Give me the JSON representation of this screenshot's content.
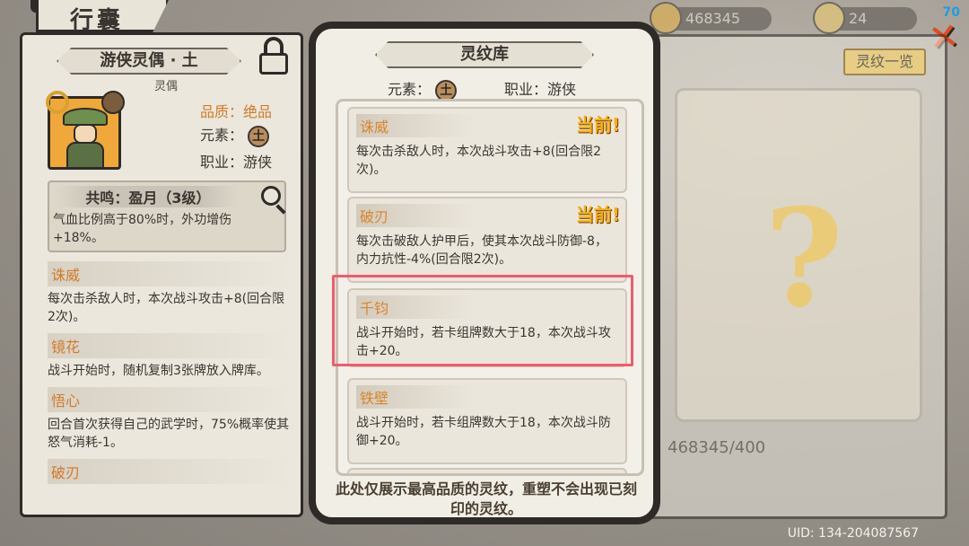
{
  "topbar": {
    "title": "行囊",
    "currency1": "468345",
    "currency2": "24",
    "level": "70"
  },
  "character": {
    "name": "游侠灵偶 · 土",
    "type": "灵偶",
    "quality_key": "品质：",
    "quality_val": "绝品",
    "element_key": "元素：",
    "element_glyph": "土",
    "job_key": "职业：",
    "job_val": "游侠",
    "resonance_title": "共鸣：盈月（3级）",
    "resonance_desc": "气血比例高于80%时，外功增伤+18%。",
    "skills": [
      {
        "name": "诛威",
        "desc": "每次击杀敌人时，本次战斗攻击+8(回合限2次)。"
      },
      {
        "name": "镜花",
        "desc": "战斗开始时，随机复制3张牌放入牌库。"
      },
      {
        "name": "悟心",
        "desc": "回合首次获得自己的武学时，75%概率使其怒气消耗-1。"
      },
      {
        "name": "破刃",
        "desc": ""
      }
    ]
  },
  "modal": {
    "title": "灵纹库",
    "element_label": "元素：",
    "element_glyph": "土",
    "job_label": "职业：",
    "job_value": "游侠",
    "current_badge": "当前!",
    "cards": [
      {
        "name": "诛威",
        "desc": "每次击杀敌人时，本次战斗攻击+8(回合限2次)。",
        "current": true
      },
      {
        "name": "破刃",
        "desc": "每次击破敌人护甲后，使其本次战斗防御-8，内力抗性-4%(回合限2次)。",
        "current": true
      },
      {
        "name": "千钧",
        "desc": "战斗开始时，若卡组牌数大于18，本次战斗攻击+20。",
        "current": false
      },
      {
        "name": "铁壁",
        "desc": "战斗开始时，若卡组牌数大于18，本次战斗防御+20。",
        "current": false
      }
    ],
    "footnote": "此处仅展示最高品质的灵纹，重塑不会出现已刻印的灵纹。"
  },
  "right_panel": {
    "overview_button": "灵纹一览",
    "placeholder": "?",
    "progress": "468345/400"
  },
  "uid": "UID: 134-204087567",
  "colors": {
    "accent_orange": "#d27a2a",
    "current_badge": "#f2b11a",
    "highlight_border": "#f15b6c",
    "level_blue": "#1e9de0"
  }
}
